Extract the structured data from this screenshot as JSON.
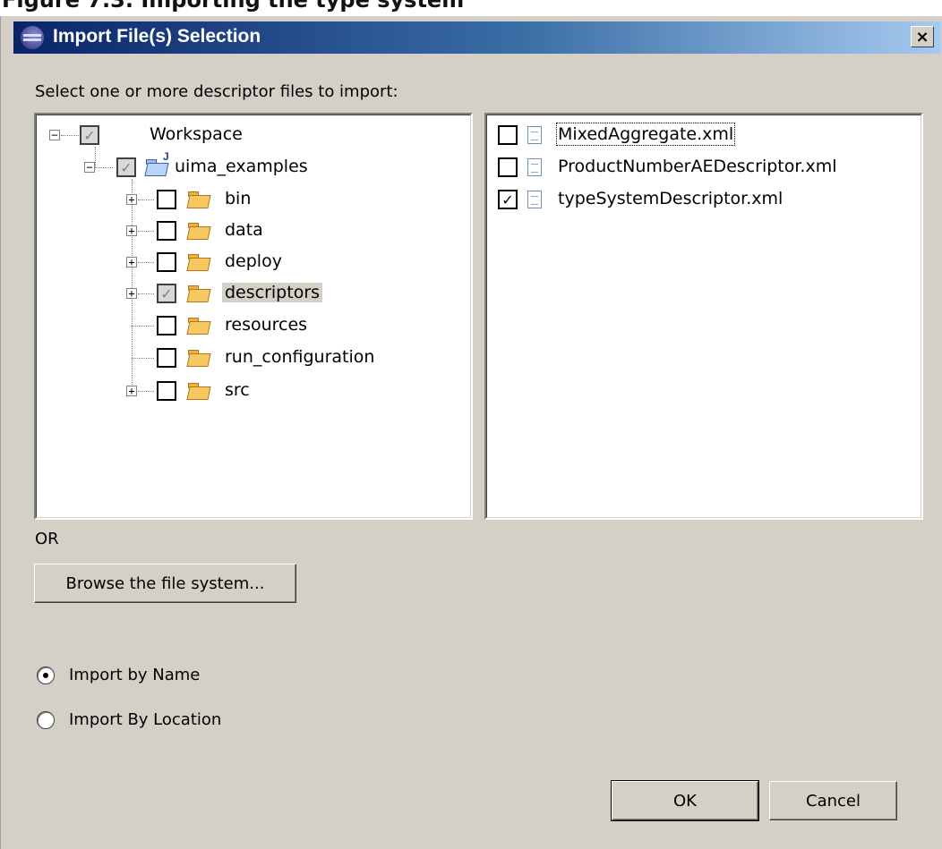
{
  "top_strip_text": "Figure 7.3. Importing the type system",
  "window": {
    "title": "Import File(s) Selection",
    "close_label": "×"
  },
  "instruction": "Select one or more descriptor files to import:",
  "tree": {
    "root": {
      "label": "Workspace",
      "checked": "grey"
    },
    "project": {
      "label": "uima_examples",
      "checked": "grey"
    },
    "folders": [
      {
        "label": "bin",
        "expander": "+",
        "checked": "none"
      },
      {
        "label": "data",
        "expander": "+",
        "checked": "none"
      },
      {
        "label": "deploy",
        "expander": "+",
        "checked": "none"
      },
      {
        "label": "descriptors",
        "expander": "+",
        "checked": "grey",
        "selected": true
      },
      {
        "label": "resources",
        "expander": "",
        "checked": "none"
      },
      {
        "label": "run_configuration",
        "expander": "",
        "checked": "none"
      },
      {
        "label": "src",
        "expander": "+",
        "checked": "none"
      }
    ]
  },
  "files": [
    {
      "label": "MixedAggregate.xml",
      "checked": false,
      "focused": true
    },
    {
      "label": "ProductNumberAEDescriptor.xml",
      "checked": false
    },
    {
      "label": "typeSystemDescriptor.xml",
      "checked": true
    }
  ],
  "or_label": "OR",
  "browse_label": "Browse the file system...",
  "radios": [
    {
      "label": "Import by Name",
      "selected": true
    },
    {
      "label": "Import By Location",
      "selected": false
    }
  ],
  "ok_label": "OK",
  "cancel_label": "Cancel"
}
